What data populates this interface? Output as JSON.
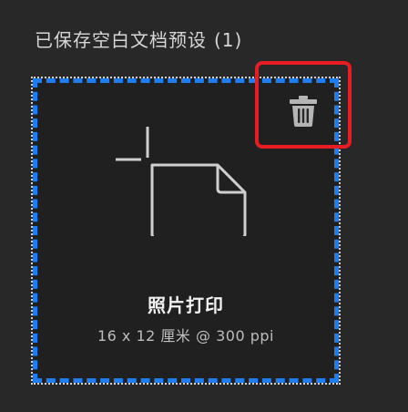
{
  "section": {
    "title": "已保存空白文档预设",
    "count": "(1)"
  },
  "presets": [
    {
      "name": "照片打印",
      "size": "16 x 12 厘米 @ 300 ppi",
      "icon": "document-icon",
      "selected": true
    }
  ],
  "actions": {
    "delete_icon": "trash-icon"
  },
  "colors": {
    "background": "#282828",
    "selection": "#1e7ef0",
    "highlight": "#e81d24"
  }
}
